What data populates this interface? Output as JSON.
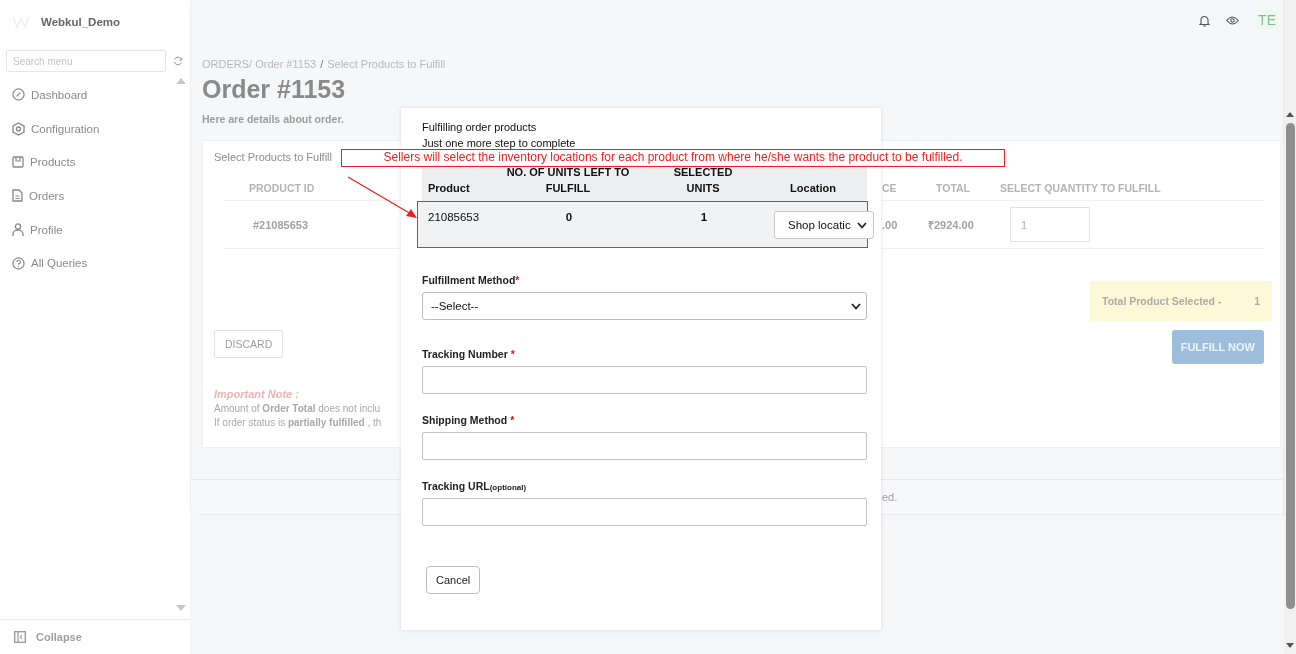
{
  "sidebar": {
    "brand": "Webkul_Demo",
    "search": {
      "placeholder": "Search menu"
    },
    "items": [
      {
        "label": "Dashboard"
      },
      {
        "label": "Configuration"
      },
      {
        "label": "Products"
      },
      {
        "label": "Orders"
      },
      {
        "label": "Profile"
      },
      {
        "label": "All Queries"
      }
    ],
    "collapse": "Collapse"
  },
  "topbar": {
    "avatar": "TE"
  },
  "breadcrumb": {
    "path": "ORDERS/ Order #1153",
    "separator": "/",
    "current": "Select Products to Fulfill"
  },
  "page": {
    "title": "Order #1153",
    "subtitle": "Here are details about order."
  },
  "card": {
    "heading": "Select Products to Fulfill",
    "columns_left": [
      "PRODUCT ID"
    ],
    "columns_right": [
      "CE",
      "TOTAL",
      "SELECT QUANTITY TO FULFILL"
    ],
    "row": {
      "product_id": "#21085653",
      "cells_right": [
        ".00",
        "₹2924.00"
      ],
      "quantity": "1"
    },
    "discard": "DISCARD",
    "total_label": "Total Product Selected -",
    "total_value": "1",
    "fulfill": "FULFILL NOW",
    "note": {
      "title": "Important Note :",
      "lines": [
        "Amount of **Order Total** does not inclu",
        "If order status is **partially fulfilled** , th"
      ]
    },
    "footer_fragment": "ed."
  },
  "modal": {
    "title": "Fulfilling order products",
    "subtitle": "Just one more step to complete",
    "table": {
      "columns": [
        "Product",
        "NO. OF UNITS LEFT TO FULFILL",
        "SELECTED UNITS",
        "Location"
      ],
      "rows": [
        {
          "product": "21085653",
          "units_left": "0",
          "selected_units": "1",
          "location": "Shop locatic"
        }
      ]
    },
    "fields": [
      {
        "kind": "select",
        "label": "Fulfillment Method",
        "required_mark": "*",
        "value": "--Select--"
      },
      {
        "kind": "text",
        "label": "Tracking Number",
        "required_mark": "*"
      },
      {
        "kind": "text",
        "label": "Shipping Method",
        "required_mark": "*"
      },
      {
        "kind": "text",
        "label": "Tracking URL",
        "optional_note": "(optional)"
      }
    ],
    "cancel": "Cancel"
  },
  "annotation": {
    "text": "Sellers will select the inventory locations for each product from where he/she wants the product to be fulfilled."
  }
}
